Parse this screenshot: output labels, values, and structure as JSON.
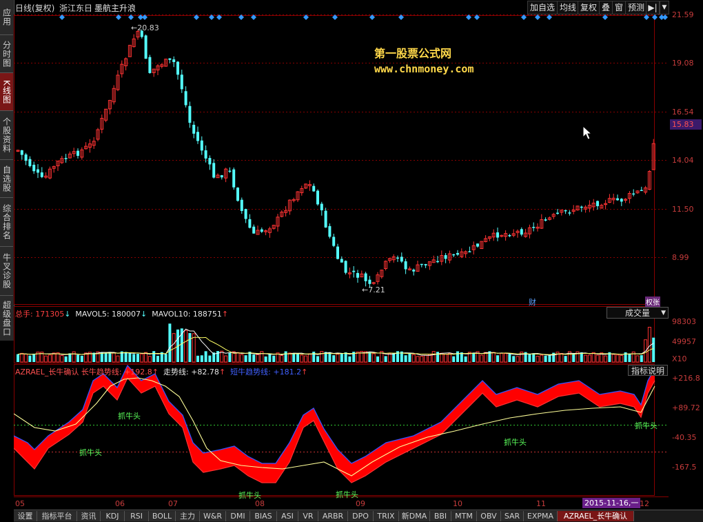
{
  "sidebar": {
    "items": [
      {
        "label": "应用",
        "active": false
      },
      {
        "label": "分时图",
        "active": false
      },
      {
        "label": "K线图",
        "active": true
      },
      {
        "label": "个股资料",
        "active": false
      },
      {
        "label": "自选股",
        "active": false
      },
      {
        "label": "综合排名",
        "active": false
      },
      {
        "label": "牛叉诊股",
        "active": false
      },
      {
        "label": "超级盘口",
        "active": false
      }
    ]
  },
  "header": {
    "period": "日线(复权)",
    "stock_name": "浙江东日",
    "tag": "墨航主升浪",
    "buttons": [
      "加自选",
      "均线",
      "复权",
      "叠",
      "窗",
      "预测"
    ],
    "nav_icon": "arrow-right-bar-icon",
    "menu_icon": "triangle-down-icon"
  },
  "watermark": {
    "line1": "第一股票公式网",
    "line2": "www.chnmoney.com"
  },
  "price_pane": {
    "axis_ticks": [
      "21.59",
      "19.08",
      "16.54",
      "14.04",
      "11.50",
      "8.99"
    ],
    "current_price": "15.83",
    "high_label": "20.83",
    "low_label": "7.21",
    "markers": [
      "财",
      "权张"
    ]
  },
  "volume_pane": {
    "legend": {
      "total_label": "总手: 171305",
      "mavol5_label": "MAVOL5: 180007",
      "mavol10_label": "MAVOL10: 188751"
    },
    "dropdown": "成交量",
    "axis_ticks": [
      "98303",
      "49957"
    ],
    "unit": "X10"
  },
  "indicator_pane": {
    "legend": {
      "name": "AZRAEL_长牛确认",
      "trend": "长牛趋势线: +192.8",
      "move": "走势线: +82.78",
      "short": "短牛趋势线: +181.2"
    },
    "help_button": "指标说明",
    "axis_ticks": [
      "+216.8",
      "+89.72",
      "-40.35",
      "-167.5"
    ],
    "annotations": [
      "抓牛头",
      "抓牛头",
      "抓牛头",
      "抓牛头",
      "抓牛头",
      "抓牛头"
    ]
  },
  "date_axis": {
    "labels": [
      "05",
      "06",
      "07",
      "08",
      "09",
      "10",
      "11",
      "12"
    ],
    "cursor_date": "2015-11-16,一"
  },
  "bottom_tabs": [
    "设置",
    "指标平台",
    "资讯",
    "KDJ",
    "RSI",
    "BOLL",
    "主力",
    "W&R",
    "DMI",
    "BIAS",
    "ASI",
    "VR",
    "ARBR",
    "DPO",
    "TRIX",
    "新DMA",
    "BBI",
    "MTM",
    "OBV",
    "SAR",
    "EXPMA",
    "AZRAEL_长牛确认"
  ],
  "colors": {
    "up": "#ff3333",
    "down": "#54ffff",
    "grid": "#8a0000",
    "axis_text": "#c83c3c",
    "fill_red": "#ff0000",
    "yellow_line": "#ffff66",
    "marker_blue": "#3399ff"
  }
}
